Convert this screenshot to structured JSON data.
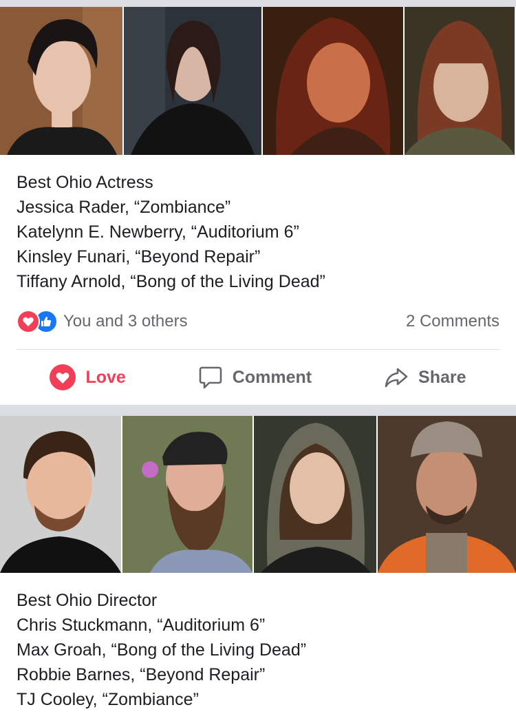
{
  "posts": [
    {
      "photos": [
        {
          "name": "photo-jessica-rader",
          "bg": "#8a5a38",
          "skin": "#e7c2ad",
          "hair": "#1a1414",
          "shirt": "#1a1a1a"
        },
        {
          "name": "photo-katelynn-newberry",
          "bg": "#2c3239",
          "skin": "#d8b6a6",
          "hair": "#2b1a16",
          "shirt": "#121212"
        },
        {
          "name": "photo-kinsley-funari",
          "bg": "#3a1e10",
          "skin": "#c9704a",
          "hair": "#6a2414",
          "shirt": "#3e2014"
        },
        {
          "name": "photo-tiffany-arnold",
          "bg": "#3b3324",
          "skin": "#d8b49c",
          "hair": "#7a3a24",
          "shirt": "#5b5840"
        }
      ],
      "caption": [
        "Best Ohio Actress",
        "Jessica Rader, “Zombiance”",
        "Katelynn E. Newberry, “Auditorium 6”",
        "Kinsley Funari, “Beyond Repair”",
        "Tiffany Arnold, “Bong of the Living Dead”"
      ],
      "reactions_text": "You and 3 others",
      "comments_text": "2 Comments",
      "actions": {
        "love": "Love",
        "comment": "Comment",
        "share": "Share"
      }
    },
    {
      "photos": [
        {
          "name": "photo-chris-stuckmann",
          "bg": "#cfcfcf",
          "skin": "#e7b89c",
          "hair": "#3a2416",
          "shirt": "#111111"
        },
        {
          "name": "photo-max-groah",
          "bg": "#6f7a55",
          "skin": "#e0ad98",
          "hair": "#5a3a22",
          "shirt": "#8b98b8"
        },
        {
          "name": "photo-robbie-barnes",
          "bg": "#34382e",
          "skin": "#e2c0a8",
          "hair": "#4a3220",
          "shirt": "#6a6a5a"
        },
        {
          "name": "photo-tj-cooley",
          "bg": "#4e3a2c",
          "skin": "#c48f72",
          "hair": "#7a6e60",
          "shirt": "#e06a28"
        }
      ],
      "caption": [
        "Best Ohio Director",
        "Chris Stuckmann, “Auditorium 6”",
        "Max Groah, “Bong of the Living Dead”",
        "Robbie Barnes, “Beyond Repair”",
        "TJ Cooley, “Zombiance”"
      ]
    }
  ],
  "colors": {
    "love": "#f33e58",
    "like": "#1877f2",
    "muted": "#65676b",
    "separator": "#dadde1"
  },
  "icons": [
    "love-icon",
    "like-icon",
    "comment-icon",
    "share-icon"
  ]
}
